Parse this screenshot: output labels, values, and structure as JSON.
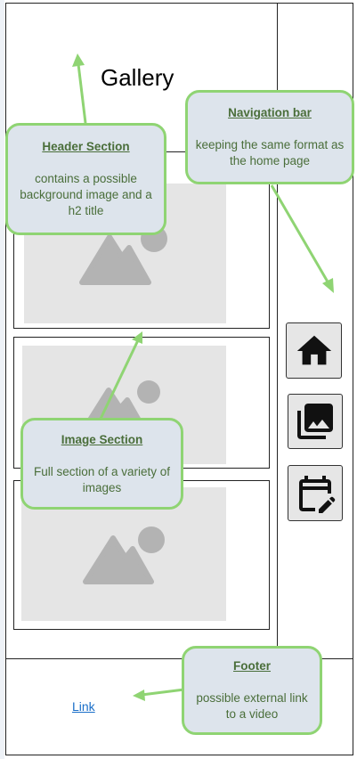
{
  "page": {
    "title": "Gallery",
    "footer_link": "Link"
  },
  "nav": {
    "items": [
      {
        "name": "home",
        "icon": "home-icon"
      },
      {
        "name": "gallery",
        "icon": "photo-library-icon"
      },
      {
        "name": "calendar",
        "icon": "edit-calendar-icon"
      }
    ]
  },
  "annotations": {
    "header": {
      "title": "Header Section",
      "body": "contains a possible background image and a h2 title"
    },
    "navigation": {
      "title": "Navigation bar",
      "body": "keeping the same format as the home page"
    },
    "image": {
      "title": "Image Section",
      "body": "Full section of a variety of images"
    },
    "footer": {
      "title": "Footer",
      "body": "possible external link to a video"
    }
  },
  "colors": {
    "callout_fill": "#dde4ec",
    "callout_border": "#8fd473",
    "callout_text": "#4a6e3a",
    "arrow": "#8fd473",
    "placeholder": "#e5e5e5",
    "placeholder_icon": "#b3b3b3",
    "link": "#1a6fc9"
  }
}
